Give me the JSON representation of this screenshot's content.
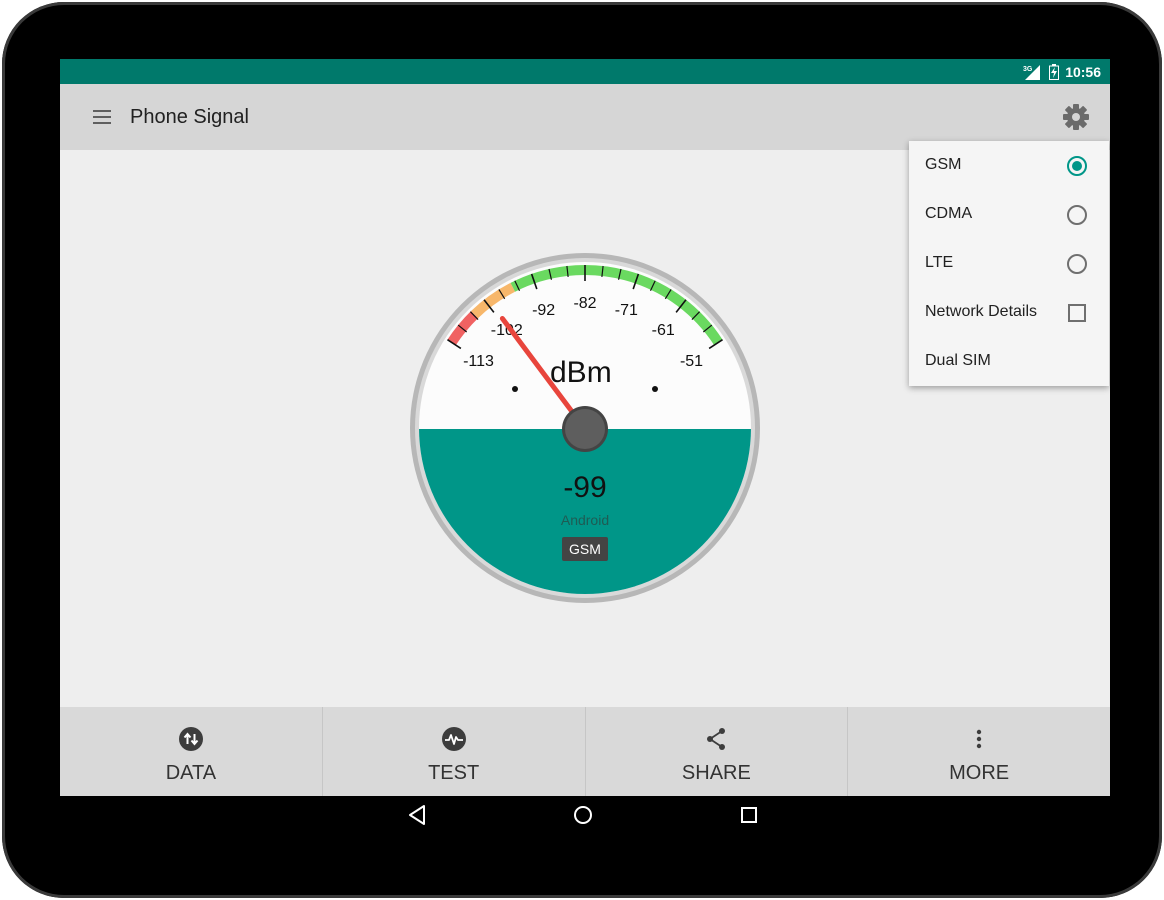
{
  "status_bar": {
    "network_label": "3G",
    "time": "10:56",
    "bar_color": "#00796b"
  },
  "app_bar": {
    "title": "Phone Signal",
    "menu_icon": "hamburger-menu-icon",
    "settings_icon": "gear-icon"
  },
  "gauge": {
    "unit": "dBm",
    "value": "-99",
    "source": "Android",
    "network_type": "GSM",
    "needle_value": -102,
    "scale_min": -113,
    "scale_max": -51,
    "tick_labels": [
      "-113",
      "-102",
      "-92",
      "-82",
      "-71",
      "-61",
      "-51"
    ],
    "zone_colors": {
      "bad": "#f06262",
      "fair": "#f7b76b",
      "good": "#6ad960"
    },
    "accent": "#009688"
  },
  "bottom_nav": {
    "items": [
      {
        "label": "DATA",
        "icon": "data-transfer-icon"
      },
      {
        "label": "TEST",
        "icon": "pulse-icon"
      },
      {
        "label": "SHARE",
        "icon": "share-icon"
      },
      {
        "label": "MORE",
        "icon": "more-vert-icon"
      }
    ]
  },
  "popup_menu": {
    "items": [
      {
        "label": "GSM",
        "control": "radio",
        "checked": true
      },
      {
        "label": "CDMA",
        "control": "radio",
        "checked": false
      },
      {
        "label": "LTE",
        "control": "radio",
        "checked": false
      },
      {
        "label": "Network Details",
        "control": "checkbox",
        "checked": false
      },
      {
        "label": "Dual SIM",
        "control": "none",
        "checked": false
      }
    ]
  },
  "system_nav": {
    "back_icon": "back-icon",
    "home_icon": "home-icon",
    "recents_icon": "recents-icon"
  }
}
